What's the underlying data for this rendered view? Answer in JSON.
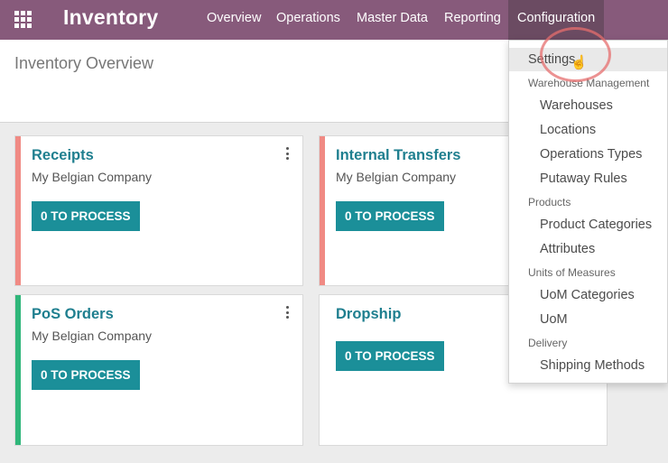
{
  "navbar": {
    "app_title": "Inventory",
    "menus": [
      "Overview",
      "Operations",
      "Master Data",
      "Reporting",
      "Configuration"
    ],
    "background": "#875a7b"
  },
  "control_panel": {
    "page_title": "Inventory Overview"
  },
  "cards": [
    {
      "title": "Receipts",
      "company": "My Belgian Company",
      "button": "0 TO PROCESS",
      "color": "#f08a84"
    },
    {
      "title": "Internal Transfers",
      "company": "My Belgian Company",
      "button": "0 TO PROCESS",
      "color": "#f08a84"
    },
    {
      "title": "PoS Orders",
      "company": "My Belgian Company",
      "button": "0 TO PROCESS",
      "color": "#2fb67a"
    },
    {
      "title": "Dropship",
      "company": "",
      "button": "0 TO PROCESS",
      "color": ""
    }
  ],
  "configuration_menu": {
    "settings": "Settings",
    "groups": [
      {
        "header": "Warehouse Management",
        "items": [
          "Warehouses",
          "Locations",
          "Operations Types",
          "Putaway Rules"
        ]
      },
      {
        "header": "Products",
        "items": [
          "Product Categories",
          "Attributes"
        ]
      },
      {
        "header": "Units of Measures",
        "items": [
          "UoM Categories",
          "UoM"
        ]
      },
      {
        "header": "Delivery",
        "items": [
          "Shipping Methods"
        ]
      }
    ]
  },
  "icons": {
    "apps": "apps-grid-icon",
    "card_menu": "kebab-menu-icon",
    "cursor": "hand-pointer-icon"
  }
}
